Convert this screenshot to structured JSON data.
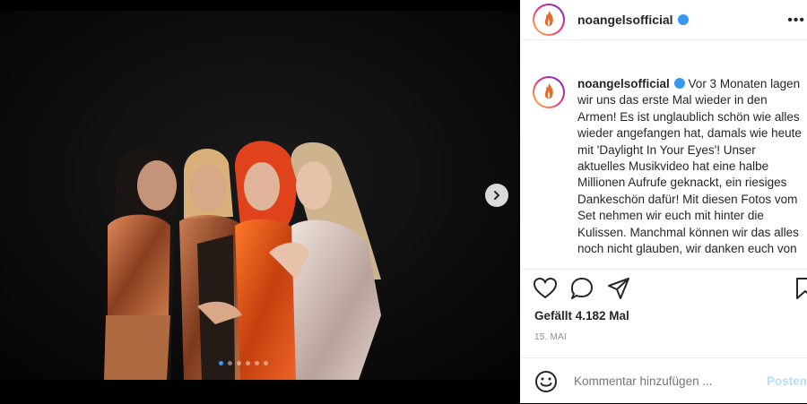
{
  "post": {
    "username": "noangelsofficial",
    "caption": "Vor 3 Monaten lagen wir uns das erste Mal wieder in den Armen! Es ist unglaublich schön wie alles wieder angefangen hat, damals wie heute mit 'Daylight In Your Eyes'! Unser aktuelles Musikvideo hat eine halbe Millionen Aufrufe geknackt, ein riesiges Dankeschön dafür! Mit diesen Fotos vom Set nehmen wir euch mit hinter die Kulissen. Manchmal können wir das alles noch nicht glauben, wir danken euch von",
    "likes": "Gefällt 4.182 Mal",
    "date": "15. MAI",
    "more_label": "•••"
  },
  "comment": {
    "placeholder": "Kommentar hinzufügen ...",
    "post_label": "Posten"
  },
  "icons": {
    "header_more": "more-icon",
    "next": "chevron-right-icon",
    "like": "heart-icon",
    "comment": "comment-icon",
    "share": "share-icon",
    "save": "bookmark-icon",
    "emoji": "emoji-icon",
    "verified": "verified-badge-icon"
  },
  "carousel": {
    "slide_count": 6,
    "active_index": 0
  },
  "colors": {
    "accent": "#3897f0",
    "text": "#262626",
    "muted": "#8e8e8e",
    "post_disabled": "#b2dffc"
  }
}
